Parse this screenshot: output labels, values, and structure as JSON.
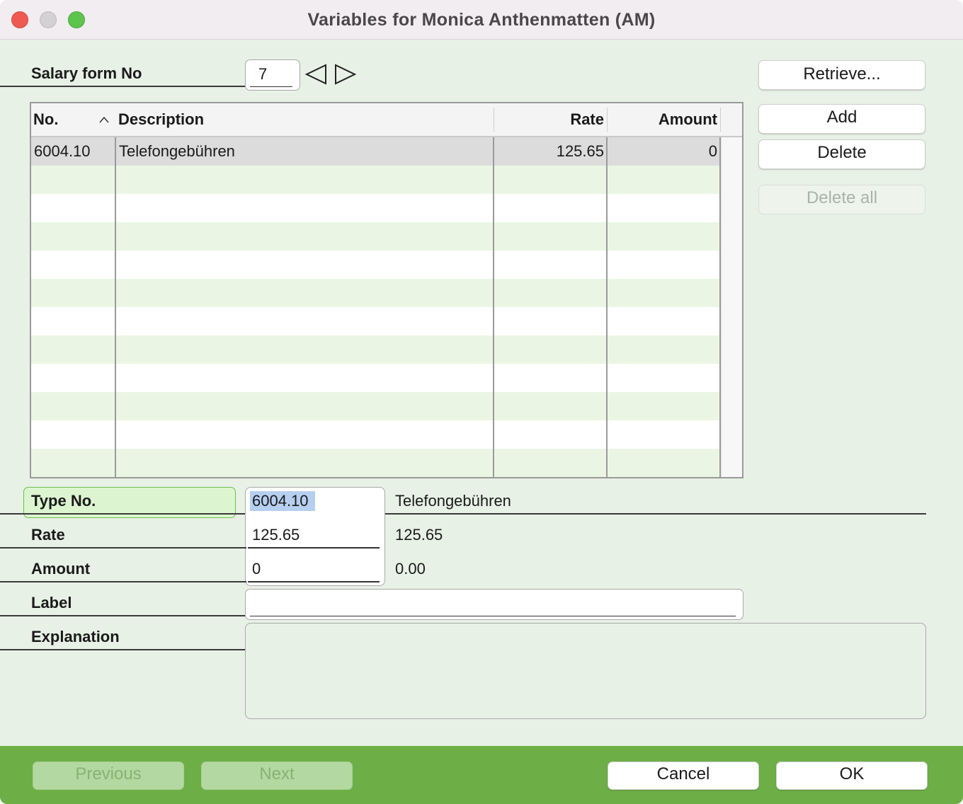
{
  "window": {
    "title": "Variables for Monica Anthenmatten  (AM)"
  },
  "salary_form": {
    "label": "Salary form No",
    "value": "7"
  },
  "buttons": {
    "retrieve": "Retrieve...",
    "add": "Add",
    "delete": "Delete",
    "delete_all": "Delete all"
  },
  "table": {
    "columns": [
      "No.",
      "Description",
      "Rate",
      "Amount"
    ],
    "sort_indicator": "^",
    "rows": [
      {
        "no": "6004.10",
        "description": "Telefongebühren",
        "rate": "125.65",
        "amount": "0"
      }
    ]
  },
  "form": {
    "type_no": {
      "label": "Type No.",
      "value": "6004.10",
      "display": "Telefongebühren"
    },
    "rate": {
      "label": "Rate",
      "value": "125.65",
      "display": "125.65"
    },
    "amount": {
      "label": "Amount",
      "value": "0",
      "display": "0.00"
    },
    "label": {
      "label": "Label",
      "value": ""
    },
    "explanation": {
      "label": "Explanation",
      "value": ""
    }
  },
  "footer": {
    "previous": "Previous",
    "next": "Next",
    "cancel": "Cancel",
    "ok": "OK"
  },
  "colors": {
    "background": "#e8f1e6",
    "footer": "#6daf46",
    "row_stripe": "#eaf6e3",
    "selected_row": "#dcdcdc",
    "selection_highlight": "#b6cff0"
  }
}
